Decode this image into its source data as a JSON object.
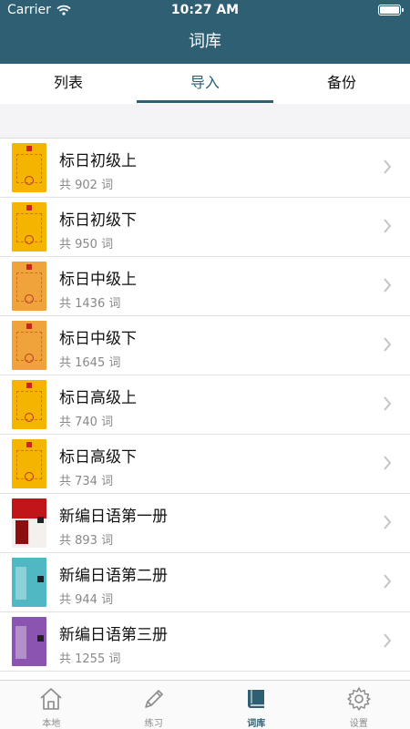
{
  "status_bar": {
    "carrier": "Carrier",
    "time": "10:27 AM",
    "battery_level": 1.0
  },
  "nav": {
    "title": "词库"
  },
  "tabs": [
    {
      "label": "列表",
      "active": false
    },
    {
      "label": "导入",
      "active": true
    },
    {
      "label": "备份",
      "active": false
    }
  ],
  "books": [
    {
      "title": "标日初级上",
      "count": "共 902 词",
      "cover_color": "#f4b400"
    },
    {
      "title": "标日初级下",
      "count": "共 950 词",
      "cover_color": "#f4b400"
    },
    {
      "title": "标日中级上",
      "count": "共 1436 词",
      "cover_color": "#f0a33a"
    },
    {
      "title": "标日中级下",
      "count": "共 1645 词",
      "cover_color": "#f0a33a"
    },
    {
      "title": "标日高级上",
      "count": "共 740 词",
      "cover_color": "#f4b400"
    },
    {
      "title": "标日高级下",
      "count": "共 734 词",
      "cover_color": "#f4b400"
    },
    {
      "title": "新编日语第一册",
      "count": "共 893 词",
      "cover_color": "#c0161a"
    },
    {
      "title": "新编日语第二册",
      "count": "共 944 词",
      "cover_color": "#4fb8c2"
    },
    {
      "title": "新编日语第三册",
      "count": "共 1255 词",
      "cover_color": "#8b54b0"
    }
  ],
  "tabbar": [
    {
      "label": "本地",
      "icon": "home-icon",
      "active": false
    },
    {
      "label": "练习",
      "icon": "pencil-icon",
      "active": false
    },
    {
      "label": "词库",
      "icon": "book-icon",
      "active": true
    },
    {
      "label": "设置",
      "icon": "gear-icon",
      "active": false
    }
  ],
  "colors": {
    "accent": "#2e5f73",
    "chevron": "#c4c4c8"
  }
}
